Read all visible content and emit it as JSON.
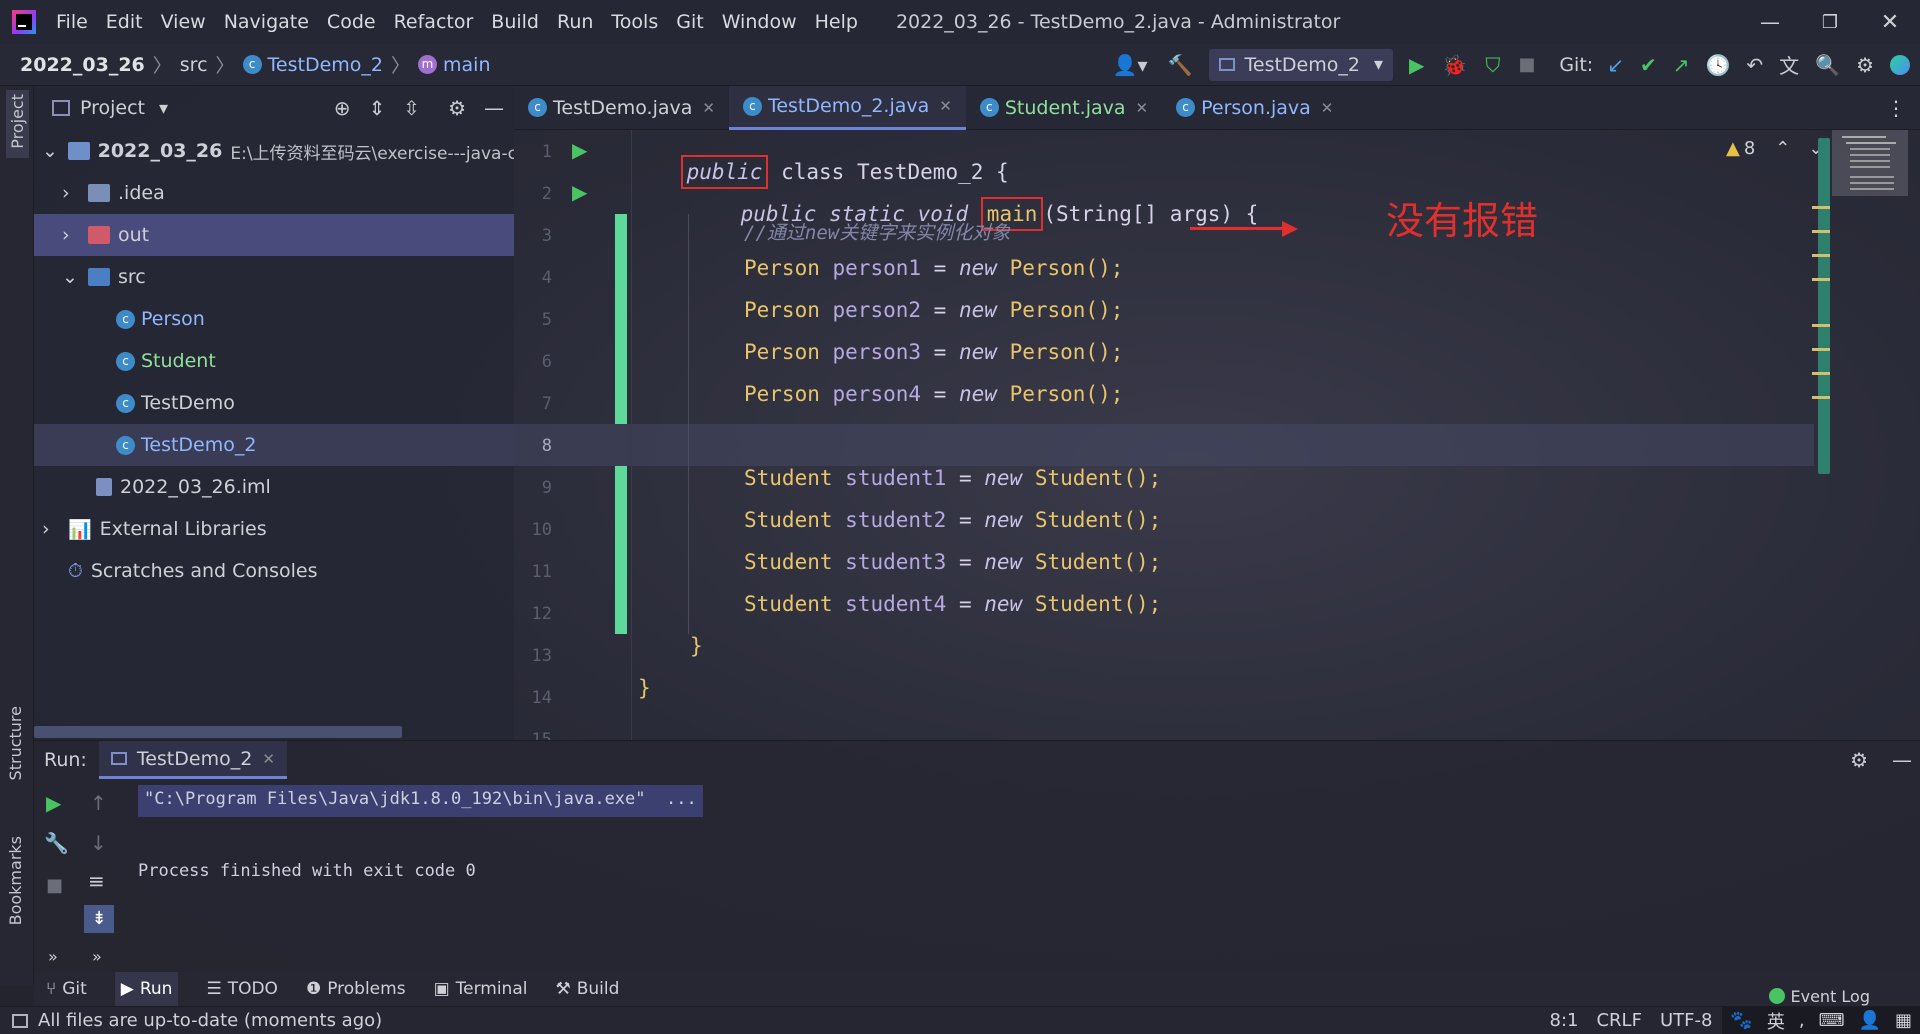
{
  "window": {
    "menu": [
      "File",
      "Edit",
      "View",
      "Navigate",
      "Code",
      "Refactor",
      "Build",
      "Run",
      "Tools",
      "Git",
      "Window",
      "Help"
    ],
    "title": "2022_03_26 - TestDemo_2.java - Administrator"
  },
  "breadcrumb": {
    "project": "2022_03_26",
    "folder": "src",
    "file": "TestDemo_2",
    "method": "main"
  },
  "toolbar": {
    "run_config": "TestDemo_2",
    "git_label": "Git:"
  },
  "project_panel": {
    "title": "Project",
    "root_name": "2022_03_26",
    "root_path": "E:\\上传资料至码云\\exercise---java-c",
    "items": [
      {
        "label": ".idea"
      },
      {
        "label": "out"
      },
      {
        "label": "src"
      },
      {
        "label": "Person"
      },
      {
        "label": "Student"
      },
      {
        "label": "TestDemo"
      },
      {
        "label": "TestDemo_2"
      },
      {
        "label": "2022_03_26.iml"
      },
      {
        "label": "External Libraries"
      },
      {
        "label": "Scratches and Consoles"
      }
    ]
  },
  "tabs": [
    {
      "label": "TestDemo.java"
    },
    {
      "label": "TestDemo_2.java"
    },
    {
      "label": "Student.java"
    },
    {
      "label": "Person.java"
    }
  ],
  "editor": {
    "warning_count": "8",
    "annotation": "没有报错",
    "line_numbers": [
      "1",
      "2",
      "3",
      "4",
      "5",
      "6",
      "7",
      "8",
      "9",
      "10",
      "11",
      "12",
      "13",
      "14",
      "15"
    ],
    "lines": {
      "l1_kw": "public",
      "l1_rest": " class TestDemo_2 {",
      "l2_a": "public static void ",
      "l2_main": "main",
      "l2_b": "(String[] args) {",
      "l3": "//通过new关键字来实例化对象",
      "p": [
        {
          "type": "Person",
          "var": "person1",
          "kw": "new",
          "call": "Person();"
        },
        {
          "type": "Person",
          "var": "person2",
          "kw": "new",
          "call": "Person();"
        },
        {
          "type": "Person",
          "var": "person3",
          "kw": "new",
          "call": "Person();"
        },
        {
          "type": "Person",
          "var": "person4",
          "kw": "new",
          "call": "Person();"
        }
      ],
      "s": [
        {
          "type": "Student",
          "var": "student1",
          "kw": "new",
          "call": "Student();"
        },
        {
          "type": "Student",
          "var": "student2",
          "kw": "new",
          "call": "Student();"
        },
        {
          "type": "Student",
          "var": "student3",
          "kw": "new",
          "call": "Student();"
        },
        {
          "type": "Student",
          "var": "student4",
          "kw": "new",
          "call": "Student();"
        }
      ],
      "l13": "}",
      "l14": "}"
    }
  },
  "run_panel": {
    "label": "Run:",
    "tab": "TestDemo_2",
    "command": "\"C:\\Program Files\\Java\\jdk1.8.0_192\\bin\\java.exe\"  ...",
    "output": "Process finished with exit code 0"
  },
  "side_labels": {
    "project": "Project",
    "structure": "Structure",
    "bookmarks": "Bookmarks"
  },
  "bottom_tools": [
    "Git",
    "Run",
    "TODO",
    "Problems",
    "Terminal",
    "Build"
  ],
  "event_log": "Event Log",
  "status": {
    "message": "All files are up-to-date (moments ago)",
    "position": "8:1",
    "line_sep": "CRLF",
    "encoding": "UTF-8",
    "ime": "英"
  },
  "colors": {
    "accent": "#6c83d8",
    "annotation": "#e0302e",
    "change_marker": "#5fd99a"
  }
}
